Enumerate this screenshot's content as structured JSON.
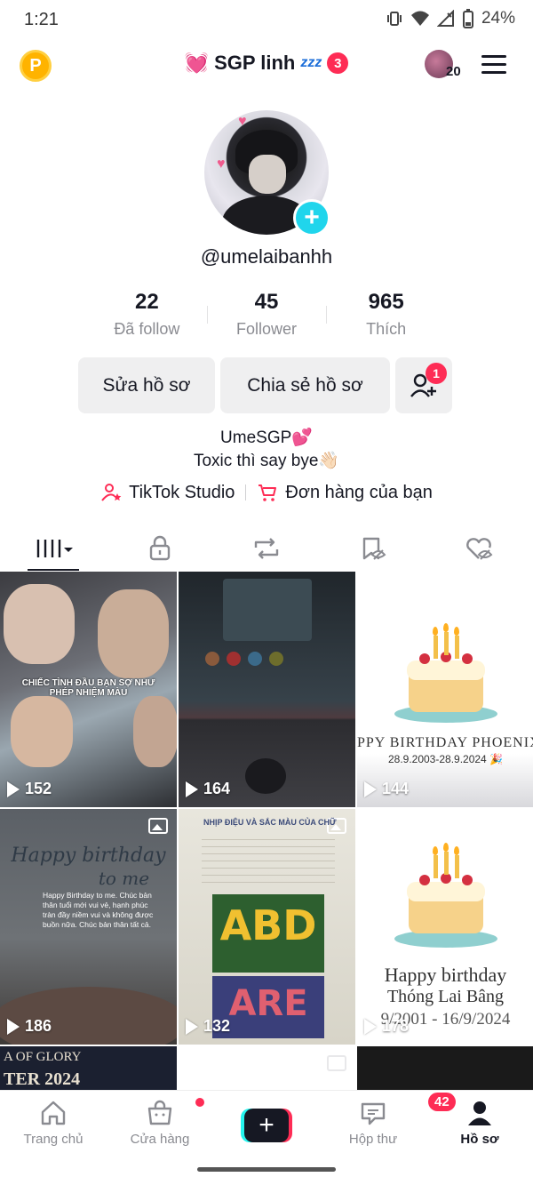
{
  "status_bar": {
    "time": "1:21",
    "battery": "24%"
  },
  "header": {
    "title": "SGP linh",
    "title_badge": "3",
    "heart": "💓",
    "zzz": "zzz",
    "avatar_count": "20"
  },
  "profile": {
    "handle": "@umelaibanhh",
    "stats": [
      {
        "value": "22",
        "label": "Đã follow"
      },
      {
        "value": "45",
        "label": "Follower"
      },
      {
        "value": "965",
        "label": "Thích"
      }
    ],
    "edit_label": "Sửa hồ sơ",
    "share_label": "Chia sẻ hồ sơ",
    "add_friend_badge": "1",
    "bio_line1": "UmeSGP💕",
    "bio_line2": "Toxic thì say bye👋🏻",
    "links": {
      "studio": "TikTok Studio",
      "orders": "Đơn hàng của bạn"
    }
  },
  "tabs": [
    "videos-tab",
    "private-tab",
    "reposts-tab",
    "favorites-tab",
    "liked-tab"
  ],
  "videos": [
    {
      "count": "152",
      "caption": "CHIẾC TÌNH ĐẦU BẠN SỢ NHƯ PHÉP NHIỆM MÀU"
    },
    {
      "count": "164"
    },
    {
      "count": "144",
      "text1": "PPY BIRTHDAY PHOENIX",
      "text2": "28.9.2003-28.9.2024 🎉"
    },
    {
      "count": "186",
      "text1": "Happy birthday",
      "text2": "to me",
      "note": "Happy Birthday to me. Chúc bản thân tuổi mới vui vẻ, hạnh phúc tràn đầy niềm vui và không được buồn nữa. Chúc bản thân tất cả."
    },
    {
      "count": "132",
      "text1": "NHỊP ĐIỆU VÀ SẮC MÀU CỦA CHỮ",
      "text2": "ABD",
      "text3": "ARE"
    },
    {
      "count": "178",
      "text1": "Happy birthday",
      "text2": "Thóng Lai Bâng",
      "text3": "9/2001 - 16/9/2024"
    },
    {
      "text1": "A OF GLORY",
      "text2": "TER 2024"
    }
  ],
  "bottom_nav": [
    {
      "label": "Trang chủ"
    },
    {
      "label": "Cửa hàng"
    },
    {
      "label": "+"
    },
    {
      "label": "Hộp thư",
      "badge": "42"
    },
    {
      "label": "Hồ sơ"
    }
  ],
  "colors": {
    "accent": "#fe2c55",
    "cyan": "#25f4ee",
    "text": "#161823",
    "muted": "#8a8b91"
  }
}
